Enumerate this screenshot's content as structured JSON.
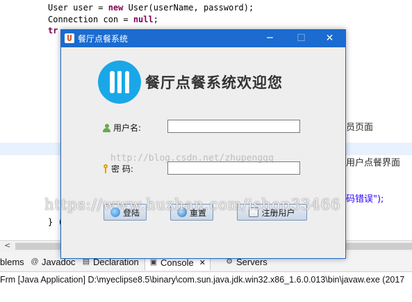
{
  "editor": {
    "line1_a": "User user = ",
    "line1_kw": "new",
    "line1_b": " User(userName, password);",
    "line2_a": "Connection con = ",
    "line2_kw": "null",
    "line2_b": ";",
    "line3_kw": "tr",
    "frag_right1": "员页面",
    "frag_right2": "用户点餐界面",
    "frag_right3": "码错误\");",
    "brace": "} ("
  },
  "views": {
    "tabs": [
      {
        "label": "blems",
        "icon": "problems-icon"
      },
      {
        "label": "Javadoc",
        "icon": "at-icon"
      },
      {
        "label": "Declaration",
        "icon": "declaration-icon"
      },
      {
        "label": "Console",
        "icon": "console-icon"
      },
      {
        "label": "Servers",
        "icon": "servers-icon"
      }
    ],
    "console_close": "✕",
    "console_title": "Frm [Java Application] D:\\myeclipse8.5\\binary\\com.sun.java.jdk.win32.x86_1.6.0.013\\bin\\javaw.exe (2017"
  },
  "dialog": {
    "title": "餐厅点餐系统",
    "banner": "餐厅点餐系统欢迎您",
    "username_label": "用户名:",
    "password_label": "密 码:",
    "username_value": "",
    "password_value": "",
    "buttons": {
      "login": "登陆",
      "reset": "重置",
      "register": "注册用户"
    },
    "window_controls": {
      "minimize": "─",
      "maximize": "☐",
      "close": "✕"
    }
  },
  "watermarks": {
    "blog": "http://blog.csdn.net/zhupengqq",
    "site": "https://www.huzhan.com/ishop33466"
  },
  "colors": {
    "titlebar": "#1b6bd0",
    "logo": "#1aa7e8",
    "keyword": "#7f0055",
    "string": "#2a00ff"
  }
}
